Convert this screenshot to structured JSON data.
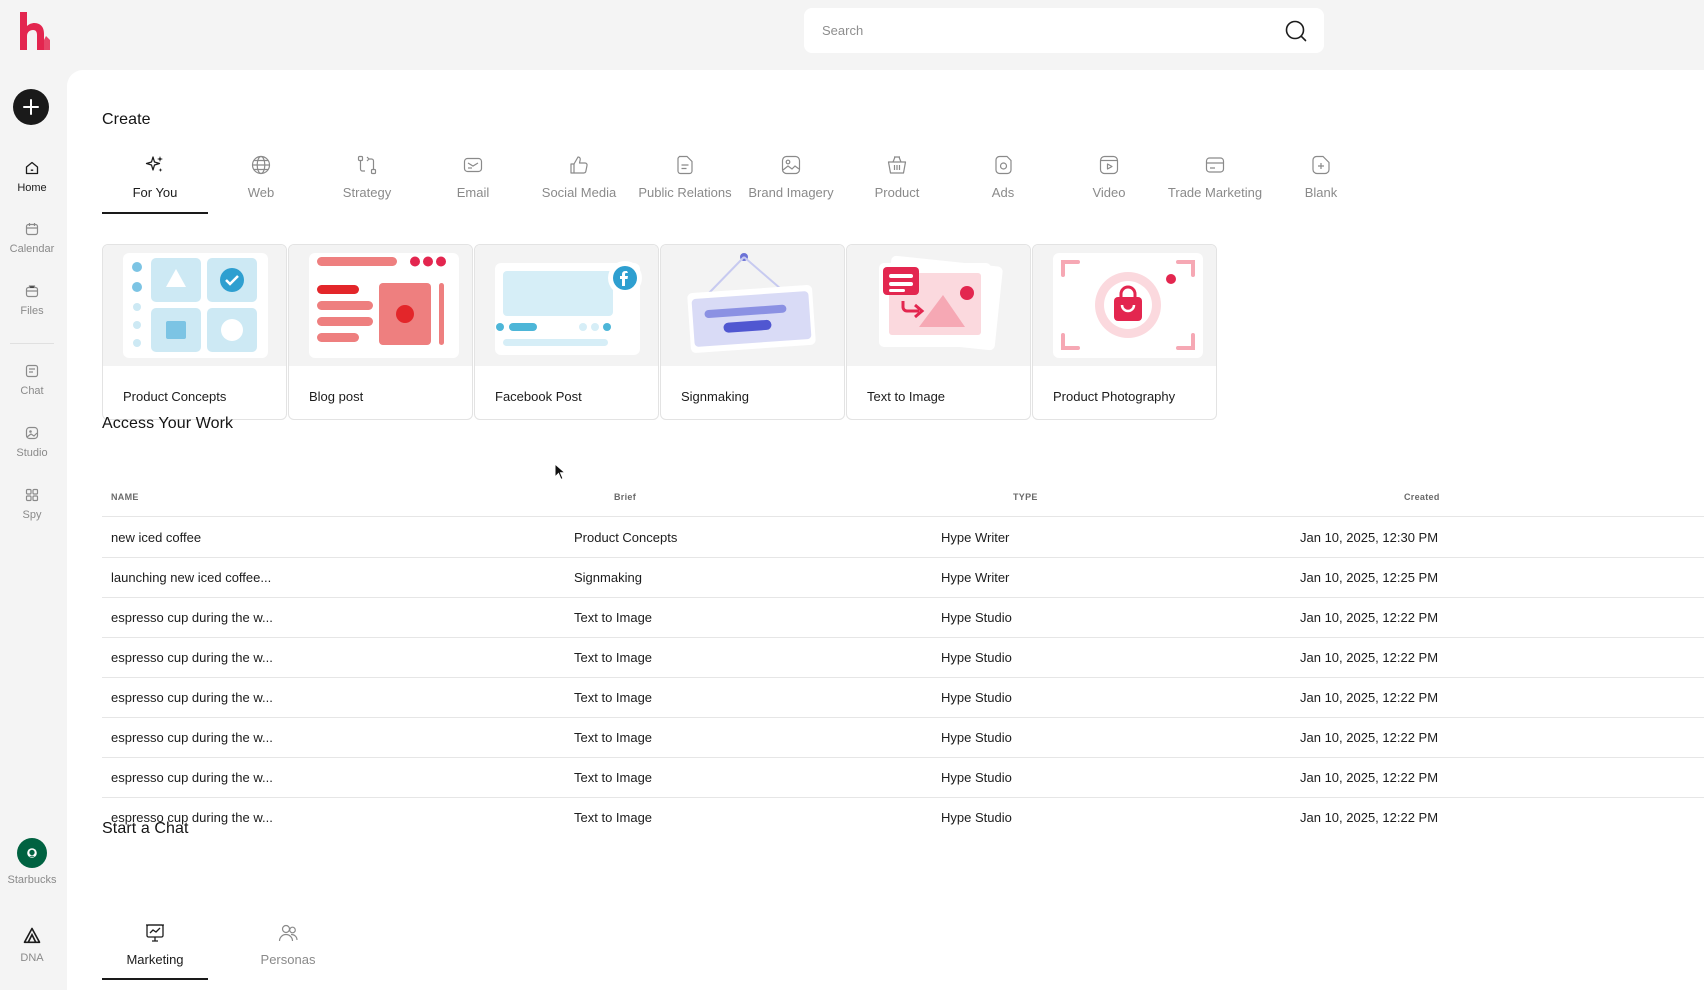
{
  "sidebar": {
    "items": [
      {
        "label": "Home",
        "icon": "home-icon"
      },
      {
        "label": "Calendar",
        "icon": "calendar-icon"
      },
      {
        "label": "Files",
        "icon": "files-icon"
      },
      {
        "label": "Chat",
        "icon": "chat-icon"
      },
      {
        "label": "Studio",
        "icon": "studio-icon"
      },
      {
        "label": "Spy",
        "icon": "spy-icon"
      }
    ],
    "brand": {
      "label": "Starbucks",
      "icon": "starbucks-logo-icon"
    },
    "dna": {
      "label": "DNA",
      "icon": "dna-icon"
    }
  },
  "search": {
    "placeholder": "Search"
  },
  "create": {
    "title": "Create",
    "tabs": [
      {
        "label": "For You",
        "icon": "sparkles-icon"
      },
      {
        "label": "Web",
        "icon": "globe-icon"
      },
      {
        "label": "Strategy",
        "icon": "strategy-icon"
      },
      {
        "label": "Email",
        "icon": "email-icon"
      },
      {
        "label": "Social Media",
        "icon": "thumbs-up-icon"
      },
      {
        "label": "Public Relations",
        "icon": "document-icon"
      },
      {
        "label": "Brand Imagery",
        "icon": "image-icon"
      },
      {
        "label": "Product",
        "icon": "basket-icon"
      },
      {
        "label": "Ads",
        "icon": "ads-icon"
      },
      {
        "label": "Video",
        "icon": "video-icon"
      },
      {
        "label": "Trade Marketing",
        "icon": "card-icon"
      },
      {
        "label": "Blank",
        "icon": "blank-doc-icon"
      }
    ],
    "cards": [
      {
        "label": "Product Concepts"
      },
      {
        "label": "Blog post"
      },
      {
        "label": "Facebook Post"
      },
      {
        "label": "Signmaking"
      },
      {
        "label": "Text to Image"
      },
      {
        "label": "Product Photography"
      }
    ]
  },
  "work": {
    "title": "Access Your Work",
    "columns": [
      "NAME",
      "Brief",
      "TYPE",
      "Created"
    ],
    "rows": [
      [
        "new iced coffee",
        "Product Concepts",
        "Hype Writer",
        "Jan 10, 2025, 12:30 PM"
      ],
      [
        "launching new iced coffee...",
        "Signmaking",
        "Hype Writer",
        "Jan 10, 2025, 12:25 PM"
      ],
      [
        "espresso cup during the w...",
        "Text to Image",
        "Hype Studio",
        "Jan 10, 2025, 12:22 PM"
      ],
      [
        "espresso cup during the w...",
        "Text to Image",
        "Hype Studio",
        "Jan 10, 2025, 12:22 PM"
      ],
      [
        "espresso cup during the w...",
        "Text to Image",
        "Hype Studio",
        "Jan 10, 2025, 12:22 PM"
      ],
      [
        "espresso cup during the w...",
        "Text to Image",
        "Hype Studio",
        "Jan 10, 2025, 12:22 PM"
      ],
      [
        "espresso cup during the w...",
        "Text to Image",
        "Hype Studio",
        "Jan 10, 2025, 12:22 PM"
      ],
      [
        "espresso cup during the w...",
        "Text to Image",
        "Hype Studio",
        "Jan 10, 2025, 12:22 PM"
      ]
    ]
  },
  "chat": {
    "title": "Start a Chat",
    "tabs": [
      {
        "label": "Marketing",
        "icon": "presentation-icon"
      },
      {
        "label": "Personas",
        "icon": "users-icon"
      }
    ]
  },
  "colors": {
    "brand": "#e3264f",
    "accent_dark": "#1a1a1a",
    "muted": "#8a8a8a"
  }
}
